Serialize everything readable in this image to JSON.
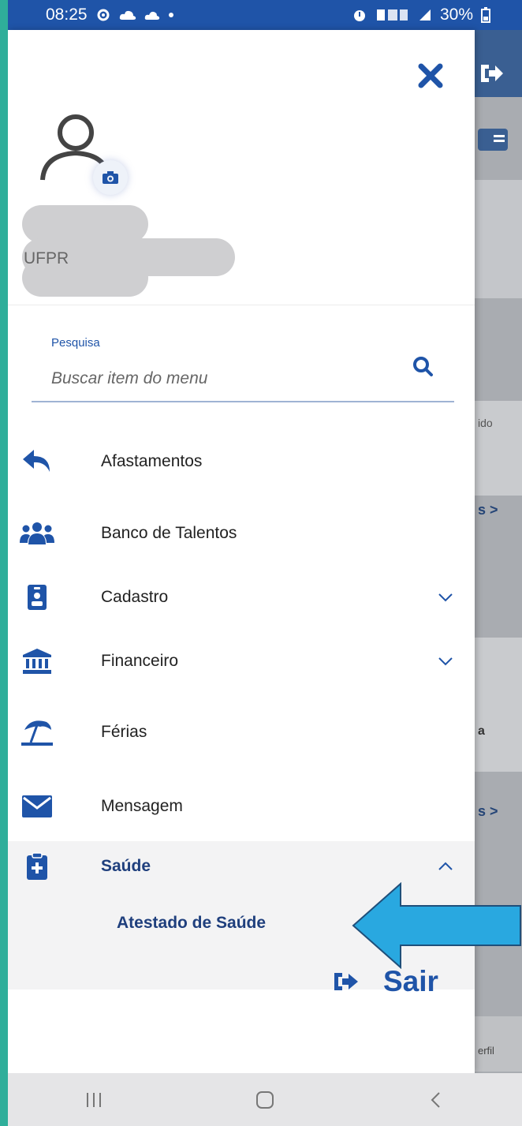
{
  "status_bar": {
    "time": "08:25",
    "left_icons": [
      "settings-gear-icon",
      "cloud-icon",
      "cloud-icon",
      "dot-icon"
    ],
    "right_icons": [
      "alarm-icon",
      "wifi-calling-icon",
      "signal-icon"
    ],
    "battery": "30%"
  },
  "drawer": {
    "org": "UFPR",
    "search": {
      "label": "Pesquisa",
      "placeholder": "Buscar item do menu",
      "value": ""
    },
    "menu": [
      {
        "label": "Afastamentos",
        "icon": "reply-arrow-icon",
        "expandable": false
      },
      {
        "label": "Banco de Talentos",
        "icon": "users-group-icon",
        "expandable": false
      },
      {
        "label": "Cadastro",
        "icon": "id-badge-icon",
        "expandable": true,
        "expanded": false
      },
      {
        "label": "Financeiro",
        "icon": "bank-icon",
        "expandable": true,
        "expanded": false
      },
      {
        "label": "Férias",
        "icon": "beach-umbrella-icon",
        "expandable": false
      },
      {
        "label": "Mensagem",
        "icon": "envelope-icon",
        "expandable": false
      },
      {
        "label": "Saúde",
        "icon": "medical-clipboard-icon",
        "expandable": true,
        "expanded": true,
        "children": [
          {
            "label": "Atestado de Saúde"
          }
        ]
      }
    ],
    "logout_label": "Sair"
  },
  "background_app": {
    "text_fragments": [
      "ido",
      "s >",
      "a",
      "s >",
      "erfil"
    ]
  },
  "colors": {
    "primary": "#1f54a8",
    "status_bar": "#1f54a8",
    "arrow": "#29a8e0"
  },
  "nav_bar": [
    "recent-apps-icon",
    "home-icon",
    "back-icon"
  ]
}
